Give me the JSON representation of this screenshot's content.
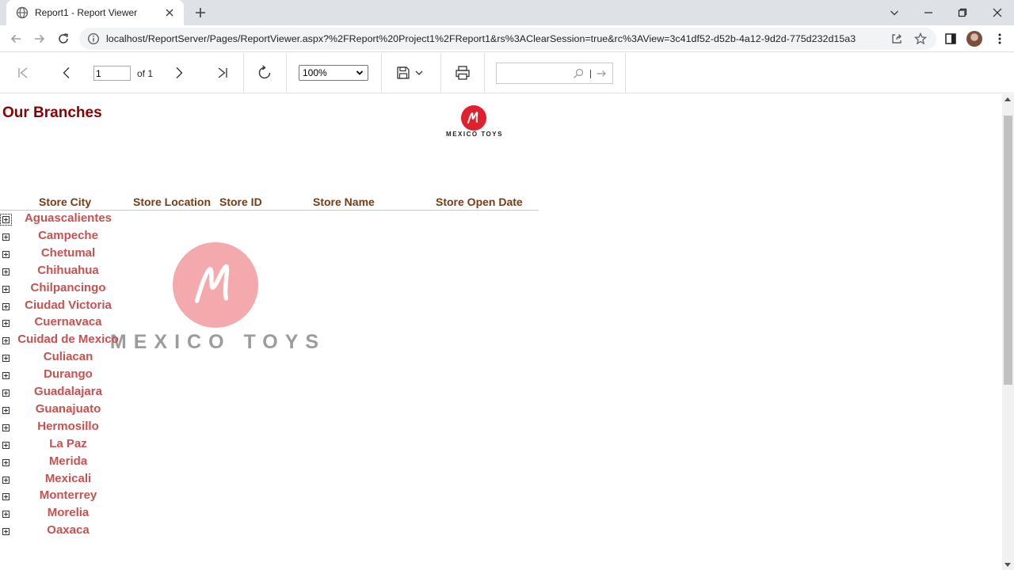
{
  "browser": {
    "tab_title": "Report1 - Report Viewer",
    "url": "localhost/ReportServer/Pages/ReportViewer.aspx?%2FReport%20Project1%2FReport1&rs%3AClearSession=true&rc%3AView=3c41df52-d52b-4a12-9d2d-775d232d15a3"
  },
  "viewer_toolbar": {
    "page_value": "1",
    "page_of": "of 1",
    "zoom": "100%",
    "find_value": ""
  },
  "report": {
    "title": "Our Branches",
    "logo_text": "MEXICO TOYS",
    "watermark_text": "MEXICO TOYS",
    "columns": [
      "Store City",
      "Store Location",
      "Store ID",
      "Store Name",
      "Store Open Date"
    ],
    "cities": [
      "Aguascalientes",
      "Campeche",
      "Chetumal",
      "Chihuahua",
      "Chilpancingo",
      "Ciudad Victoria",
      "Cuernavaca",
      "Cuidad de Mexico",
      "Culiacan",
      "Durango",
      "Guadalajara",
      "Guanajuato",
      "Hermosillo",
      "La Paz",
      "Merida",
      "Mexicali",
      "Monterrey",
      "Morelia",
      "Oaxaca"
    ]
  },
  "colors": {
    "title": "#8b0000",
    "header": "#7a3a12",
    "city": "#c9514f",
    "logo_red": "#e0202e"
  },
  "icons": [
    "globe-icon",
    "close-icon",
    "plus-icon",
    "back-icon",
    "forward-icon",
    "reload-icon",
    "info-icon",
    "share-icon",
    "star-icon",
    "sidebar-icon",
    "menu-icon",
    "first-page-icon",
    "previous-page-icon",
    "next-page-icon",
    "last-page-icon",
    "refresh-icon",
    "save-icon",
    "print-icon",
    "search-icon",
    "find-next-icon",
    "expand-icon"
  ]
}
